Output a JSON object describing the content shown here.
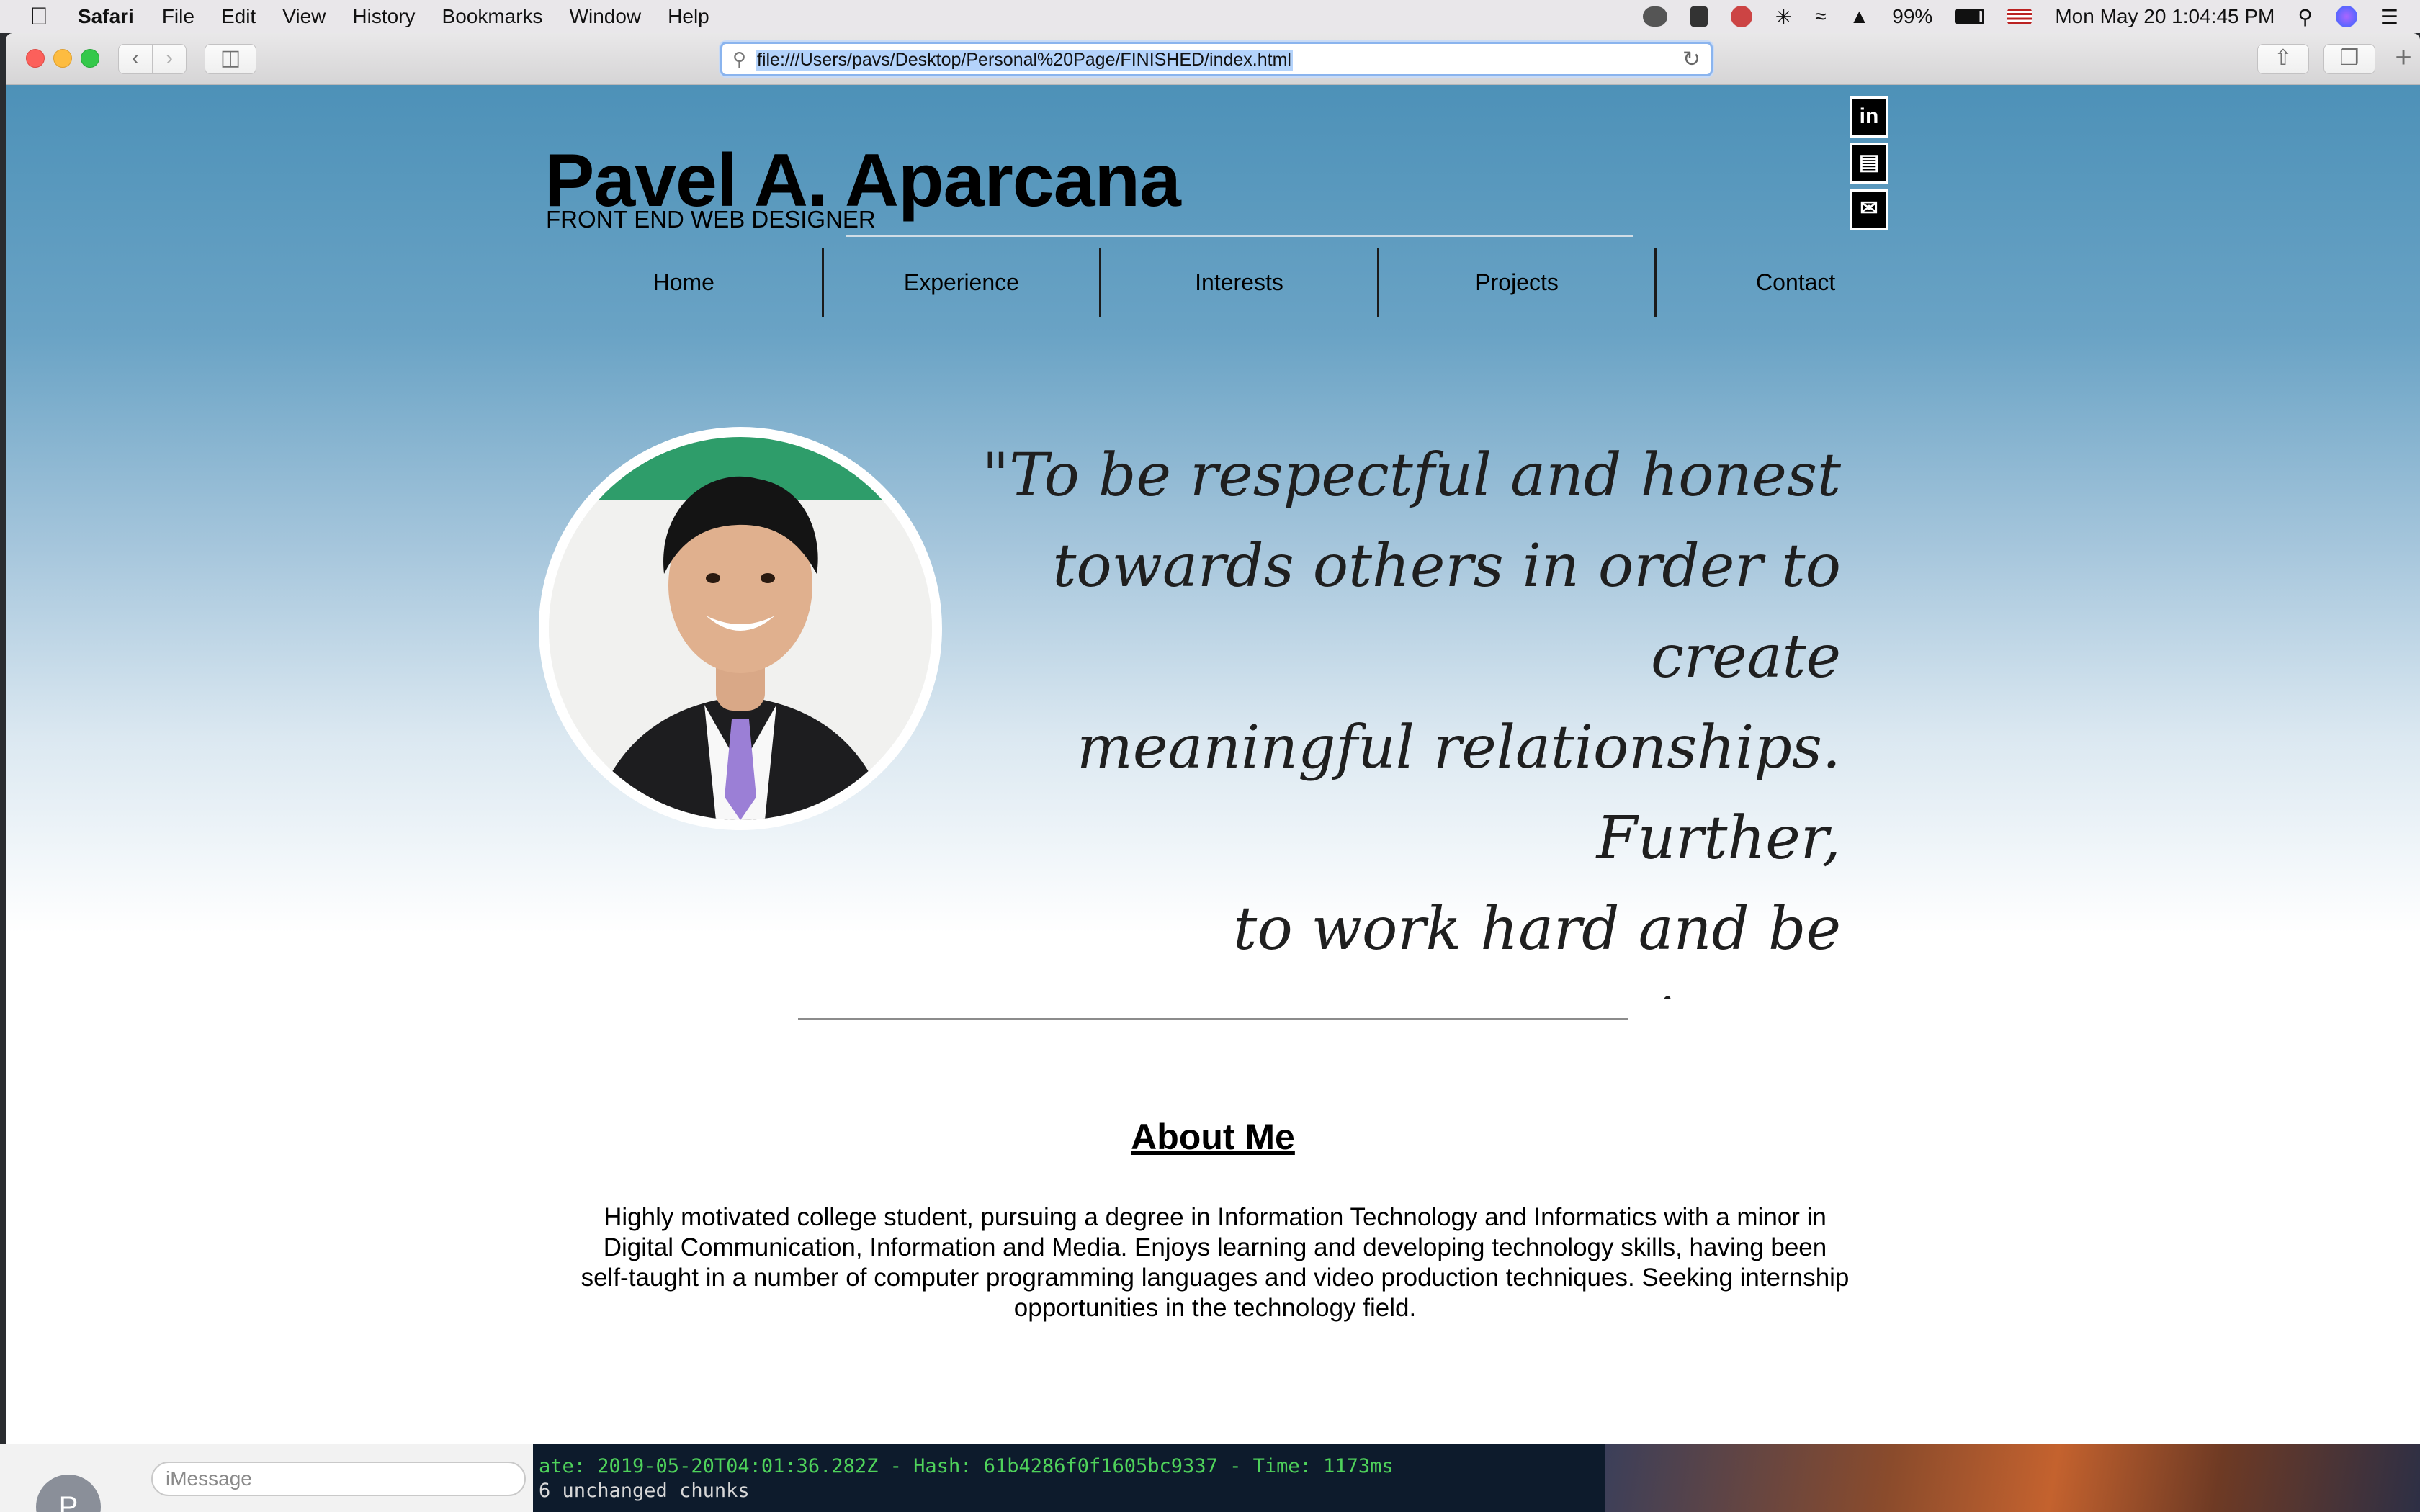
{
  "menubar": {
    "app_name": "Safari",
    "items": [
      "File",
      "Edit",
      "View",
      "History",
      "Bookmarks",
      "Window",
      "Help"
    ],
    "battery": "99%",
    "datetime": "Mon May 20  1:04:45 PM"
  },
  "browser": {
    "url": "file:///Users/pavs/Desktop/Personal%20Page/FINISHED/index.html"
  },
  "site": {
    "name": "Pavel A. Aparcana",
    "subtitle": "FRONT END WEB DESIGNER",
    "nav": [
      "Home",
      "Experience",
      "Interests",
      "Projects",
      "Contact"
    ],
    "social_icons": [
      "linkedin-icon",
      "document-icon",
      "envelope-icon"
    ],
    "quote": "\"To be respectful and honest\ntowards others in order to create\nmeaningful relationships. Further,\nto work hard and be passionate\nabout the positions I hold to be\nsuccesful.\"",
    "about_title": "About Me",
    "about_body": "Highly motivated college student, pursuing a degree in Information Technology and Informatics with a minor in Digital Communication, Information and Media. Enjoys learning and developing technology skills, having been self-taught in a number of computer programming languages and video production techniques. Seeking internship opportunities in the technology field."
  },
  "background": {
    "messages_placeholder": "iMessage",
    "terminal_line1": "ate: 2019-05-20T04:01:36.282Z - Hash: 61b4286f0f1605bc9337 - Time: 1173ms",
    "terminal_line2": "6 unchanged chunks"
  },
  "colors": {
    "hero_top": "#4d91b8",
    "address_focus": "#8ab4ee"
  }
}
